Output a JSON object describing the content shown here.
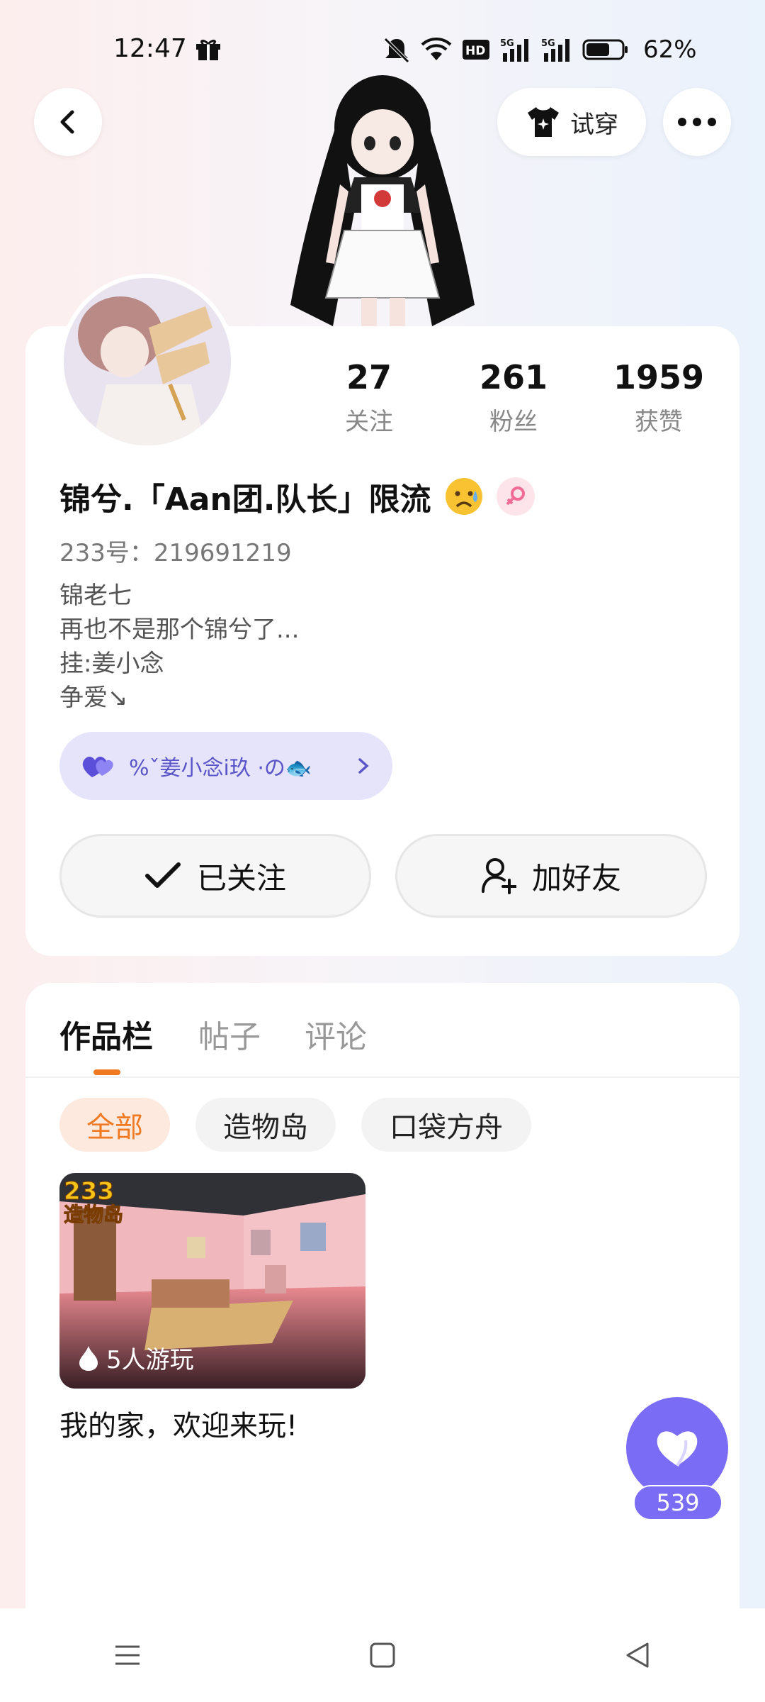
{
  "status_bar": {
    "time": "12:47",
    "battery": "62%",
    "icons": [
      "gift-icon",
      "mute-icon",
      "wifi-icon",
      "hd-icon",
      "signal-5g-icon",
      "signal-5g-icon",
      "battery-icon"
    ]
  },
  "header": {
    "try_on_label": "试穿"
  },
  "stats": [
    {
      "value": "27",
      "label": "关注"
    },
    {
      "value": "261",
      "label": "粉丝"
    },
    {
      "value": "1959",
      "label": "获赞"
    }
  ],
  "profile": {
    "username": "锦兮.「Aan团.队长」限流",
    "user_id": "233号：219691219",
    "bio": [
      "锦老七",
      "再也不是那个锦兮了...",
      "挂:姜小念",
      "争爱↘"
    ],
    "cp_text": "%ˇ姜小念i玖 ·の🐟"
  },
  "actions": {
    "followed_label": "已关注",
    "add_friend_label": "加好友"
  },
  "tabs": [
    "作品栏",
    "帖子",
    "评论"
  ],
  "filters": [
    "全部",
    "造物岛",
    "口袋方舟"
  ],
  "works": [
    {
      "title": "我的家，欢迎来玩!",
      "plays": "5人游玩",
      "badge_top": "233",
      "badge_bottom": "造物岛"
    }
  ],
  "like_fab": {
    "count": "539"
  },
  "colors": {
    "accent": "#f07a22",
    "purple": "#7b6cf5",
    "cp_bg": "#e6e4fb"
  }
}
